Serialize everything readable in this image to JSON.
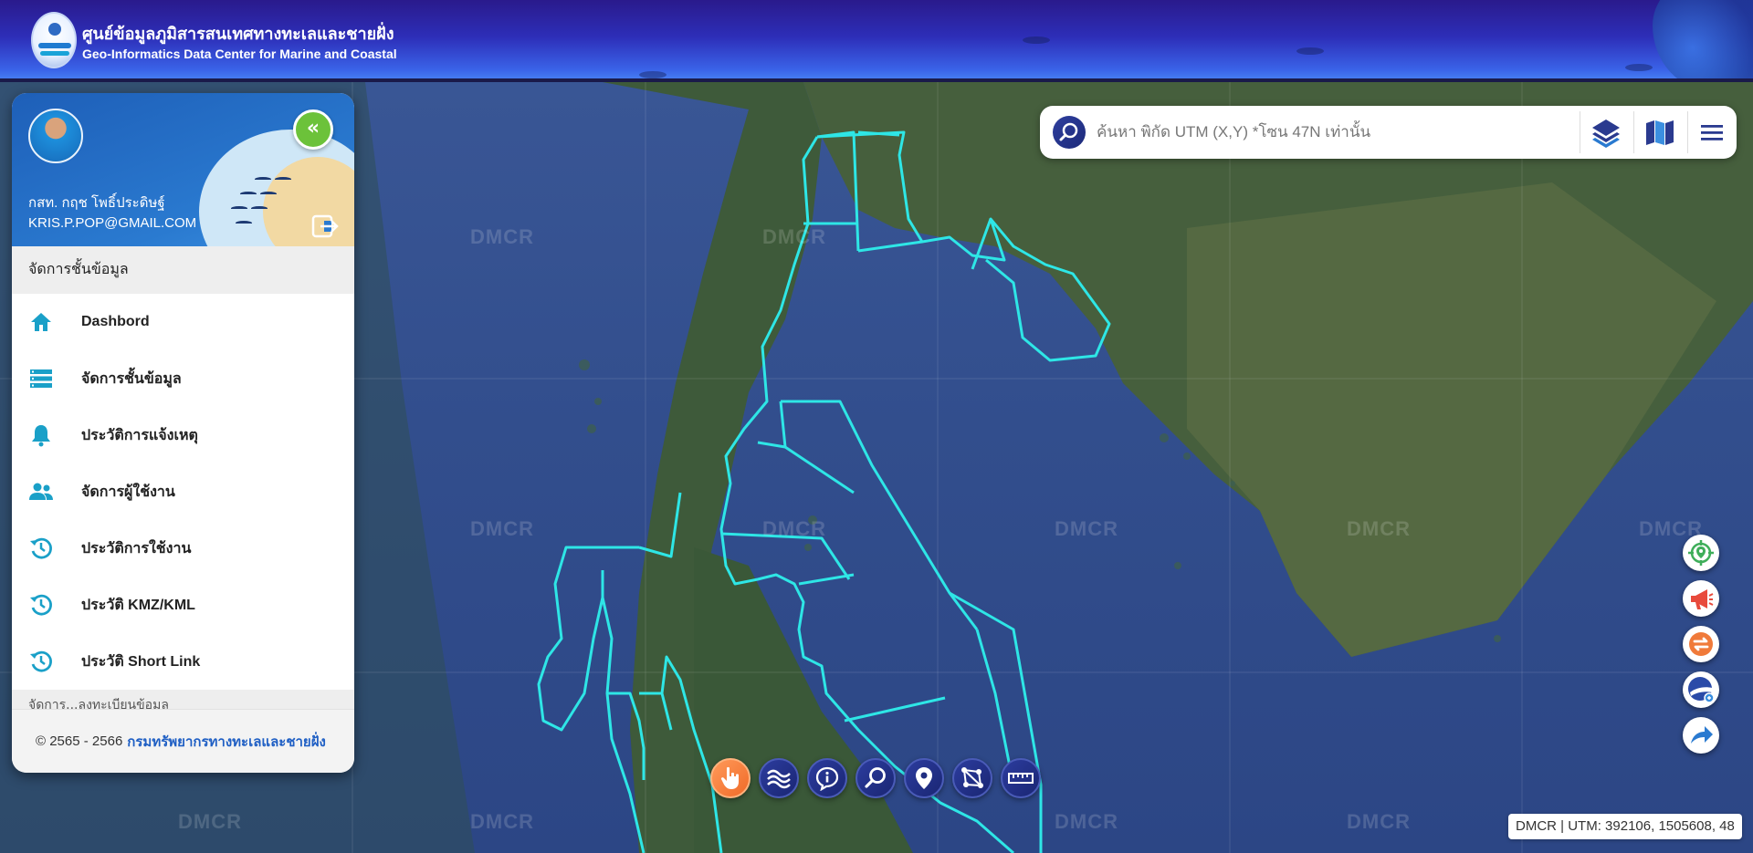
{
  "header": {
    "title_th": "ศูนย์ข้อมูลภูมิสารสนเทศทางทะเลและชายฝั่ง",
    "title_en": "Geo-Informatics Data Center for Marine and Coastal"
  },
  "sidebar": {
    "user_name": "กสท. กฤช โพธิ์ประดิษฐ์",
    "user_email": "KRIS.P.POP@GMAIL.COM",
    "section_label": "จัดการชั้นข้อมูล",
    "items": [
      {
        "label": "Dashbord",
        "icon": "home-icon"
      },
      {
        "label": "จัดการชั้นข้อมูล",
        "icon": "layers-list-icon"
      },
      {
        "label": "ประวัติการแจ้งเหตุ",
        "icon": "bell-icon"
      },
      {
        "label": "จัดการผู้ใช้งาน",
        "icon": "users-icon"
      },
      {
        "label": "ประวัติการใช้งาน",
        "icon": "history-icon"
      },
      {
        "label": "ประวัติ KMZ/KML",
        "icon": "history-icon"
      },
      {
        "label": "ประวัติ Short Link",
        "icon": "history-icon"
      }
    ],
    "next_section_partial": "จัดการ...ลงทะเบียนข้อมูล",
    "footer_copy": "© 2565 - 2566",
    "footer_org": "กรมทรัพยากรทางทะเลและชายฝั่ง"
  },
  "search": {
    "placeholder": "ค้นหา พิกัด UTM (X,Y) *โซน 47N เท่านั้น",
    "value": ""
  },
  "map": {
    "watermark": "DMCR",
    "boundary_color": "#2ee6e6"
  },
  "right_tools": [
    "locate-icon",
    "megaphone-icon",
    "swap-icon",
    "google-earth-icon",
    "share-icon"
  ],
  "bottom_tools": [
    "hand-pointer-icon",
    "tide-icon",
    "info-icon",
    "zoom-search-icon",
    "pin-icon",
    "polygon-icon",
    "ruler-icon"
  ],
  "status": {
    "text": "DMCR | UTM: 392106, 1505608, 48"
  },
  "colors": {
    "header_dark": "#2a1a8c",
    "header_light": "#4a86f5",
    "accent_green": "#6cc23a",
    "menu_icon": "#1aa0c8",
    "footer_link": "#1f5fc4",
    "active_tool": "#f06a28"
  }
}
